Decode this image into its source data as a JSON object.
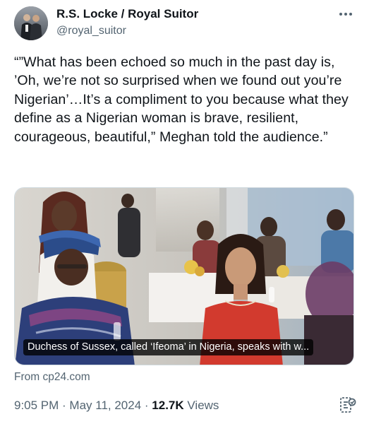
{
  "author": {
    "name": "R.S. Locke / Royal Suitor",
    "handle": "@royal_suitor"
  },
  "tweet": {
    "text": "“”What has been echoed so much in the past day is, ’Oh, we’re not so surprised when we found out you’re Nigerian’…It’s a compliment to you because what they define as a Nigerian woman is brave, resilient, courageous, beautiful,” Meghan told the audience.”"
  },
  "media": {
    "caption": "Duchess of Sussex, called ‘Ifeoma’ in Nigeria, speaks with w..."
  },
  "source": {
    "text": "From cp24.com"
  },
  "meta": {
    "time": "9:05 PM",
    "separator1": " · ",
    "date": "May 11, 2024",
    "separator2": " · ",
    "views_count": "12.7K",
    "views_label": " Views"
  },
  "icons": {
    "more": "more-horizontal-icon",
    "analytics": "bookmark-analytics-icon"
  },
  "colors": {
    "text_primary": "#0f1419",
    "text_secondary": "#536471",
    "border": "#cfd9de"
  }
}
